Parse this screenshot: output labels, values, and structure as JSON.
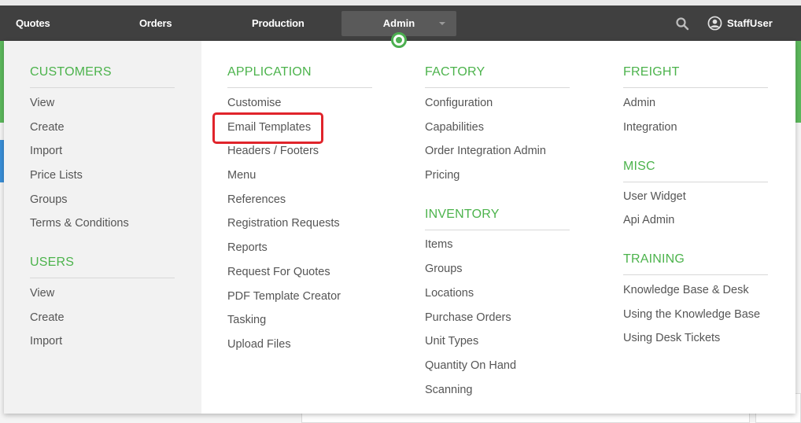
{
  "colors": {
    "topbar": "#404040",
    "accent_green": "#4cb34c",
    "highlight_red": "#e0242b",
    "link_text": "#555555"
  },
  "topnav": {
    "items": [
      "Quotes",
      "Orders",
      "Production"
    ],
    "active": "Admin",
    "search_icon": "search-icon",
    "user_icon": "user-circle-icon",
    "user": "StaffUser"
  },
  "menu": {
    "customers": {
      "title": "CUSTOMERS",
      "links": [
        "View",
        "Create",
        "Import",
        "Price Lists",
        "Groups",
        "Terms & Conditions"
      ]
    },
    "users": {
      "title": "USERS",
      "links": [
        "View",
        "Create",
        "Import"
      ]
    },
    "application": {
      "title": "APPLICATION",
      "links": [
        "Customise",
        "Email Templates",
        "Headers / Footers",
        "Menu",
        "References",
        "Registration Requests",
        "Reports",
        "Request For Quotes",
        "PDF Template Creator",
        "Tasking",
        "Upload Files"
      ]
    },
    "factory": {
      "title": "FACTORY",
      "links": [
        "Configuration",
        "Capabilities",
        "Order Integration Admin",
        "Pricing"
      ]
    },
    "inventory": {
      "title": "INVENTORY",
      "links": [
        "Items",
        "Groups",
        "Locations",
        "Purchase Orders",
        "Unit Types",
        "Quantity On Hand",
        "Scanning"
      ]
    },
    "freight": {
      "title": "FREIGHT",
      "links": [
        "Admin",
        "Integration"
      ]
    },
    "misc": {
      "title": "MISC",
      "links": [
        "User Widget",
        "Api Admin"
      ]
    },
    "training": {
      "title": "TRAINING",
      "links": [
        "Knowledge Base & Desk",
        "Using the Knowledge Base",
        "Using Desk Tickets"
      ]
    }
  }
}
